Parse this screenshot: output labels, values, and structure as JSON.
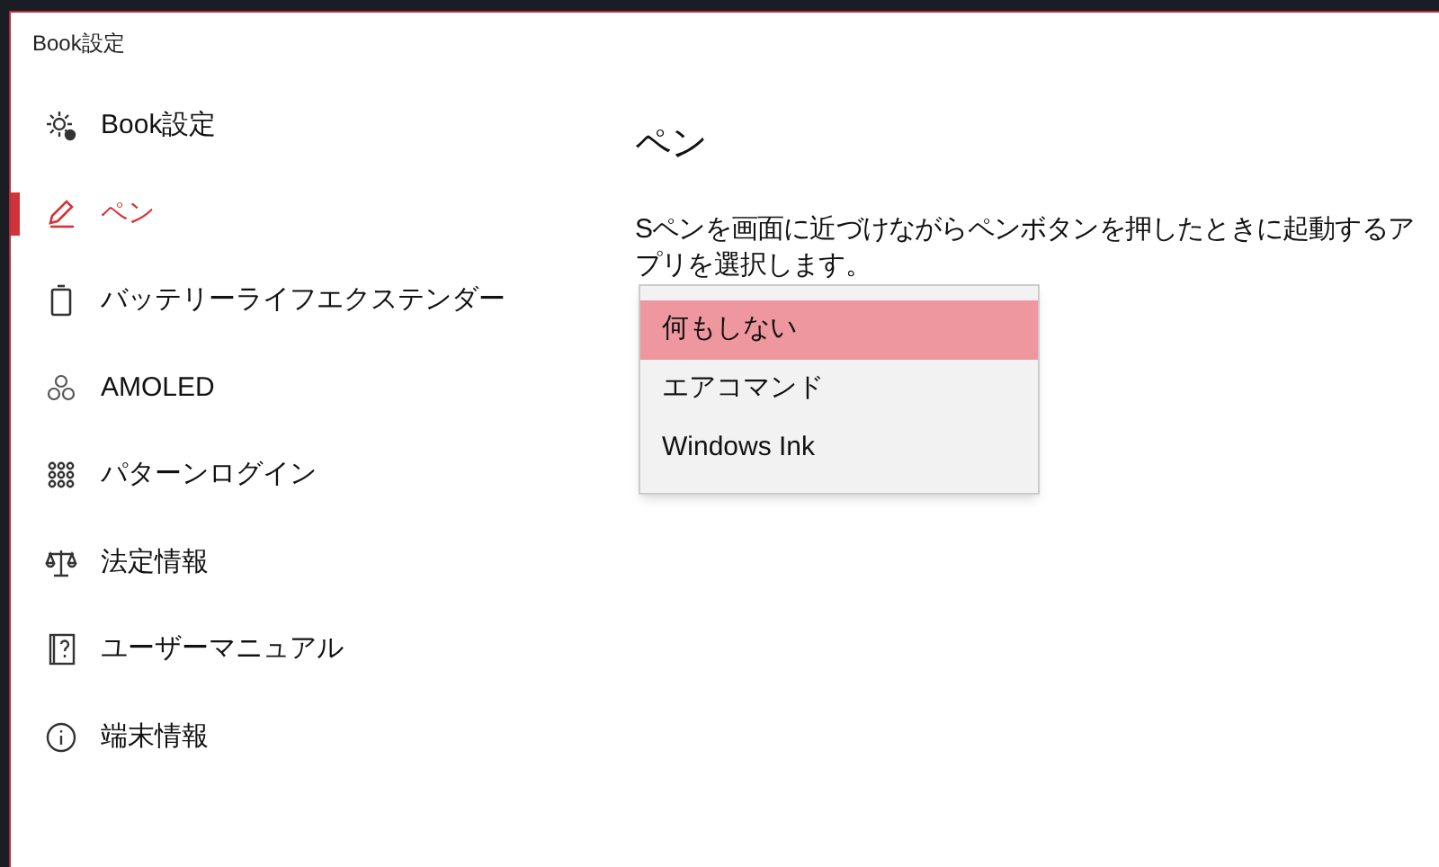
{
  "window": {
    "title": "Book設定"
  },
  "sidebar": {
    "items": [
      {
        "label": "Book設定",
        "selected": false
      },
      {
        "label": "ペン",
        "selected": true
      },
      {
        "label": "バッテリーライフエクステンダー",
        "selected": false
      },
      {
        "label": "AMOLED",
        "selected": false
      },
      {
        "label": "パターンログイン",
        "selected": false
      },
      {
        "label": "法定情報",
        "selected": false
      },
      {
        "label": "ユーザーマニュアル",
        "selected": false
      },
      {
        "label": "端末情報",
        "selected": false
      }
    ]
  },
  "content": {
    "heading": "ペン",
    "description": "Sペンを画面に近づけながらペンボタンを押したときに起動するアプリを選択します。",
    "dropdown_options": [
      {
        "label": "何もしない",
        "selected": true
      },
      {
        "label": "エアコマンド",
        "selected": false
      },
      {
        "label": "Windows Ink",
        "selected": false
      }
    ]
  }
}
